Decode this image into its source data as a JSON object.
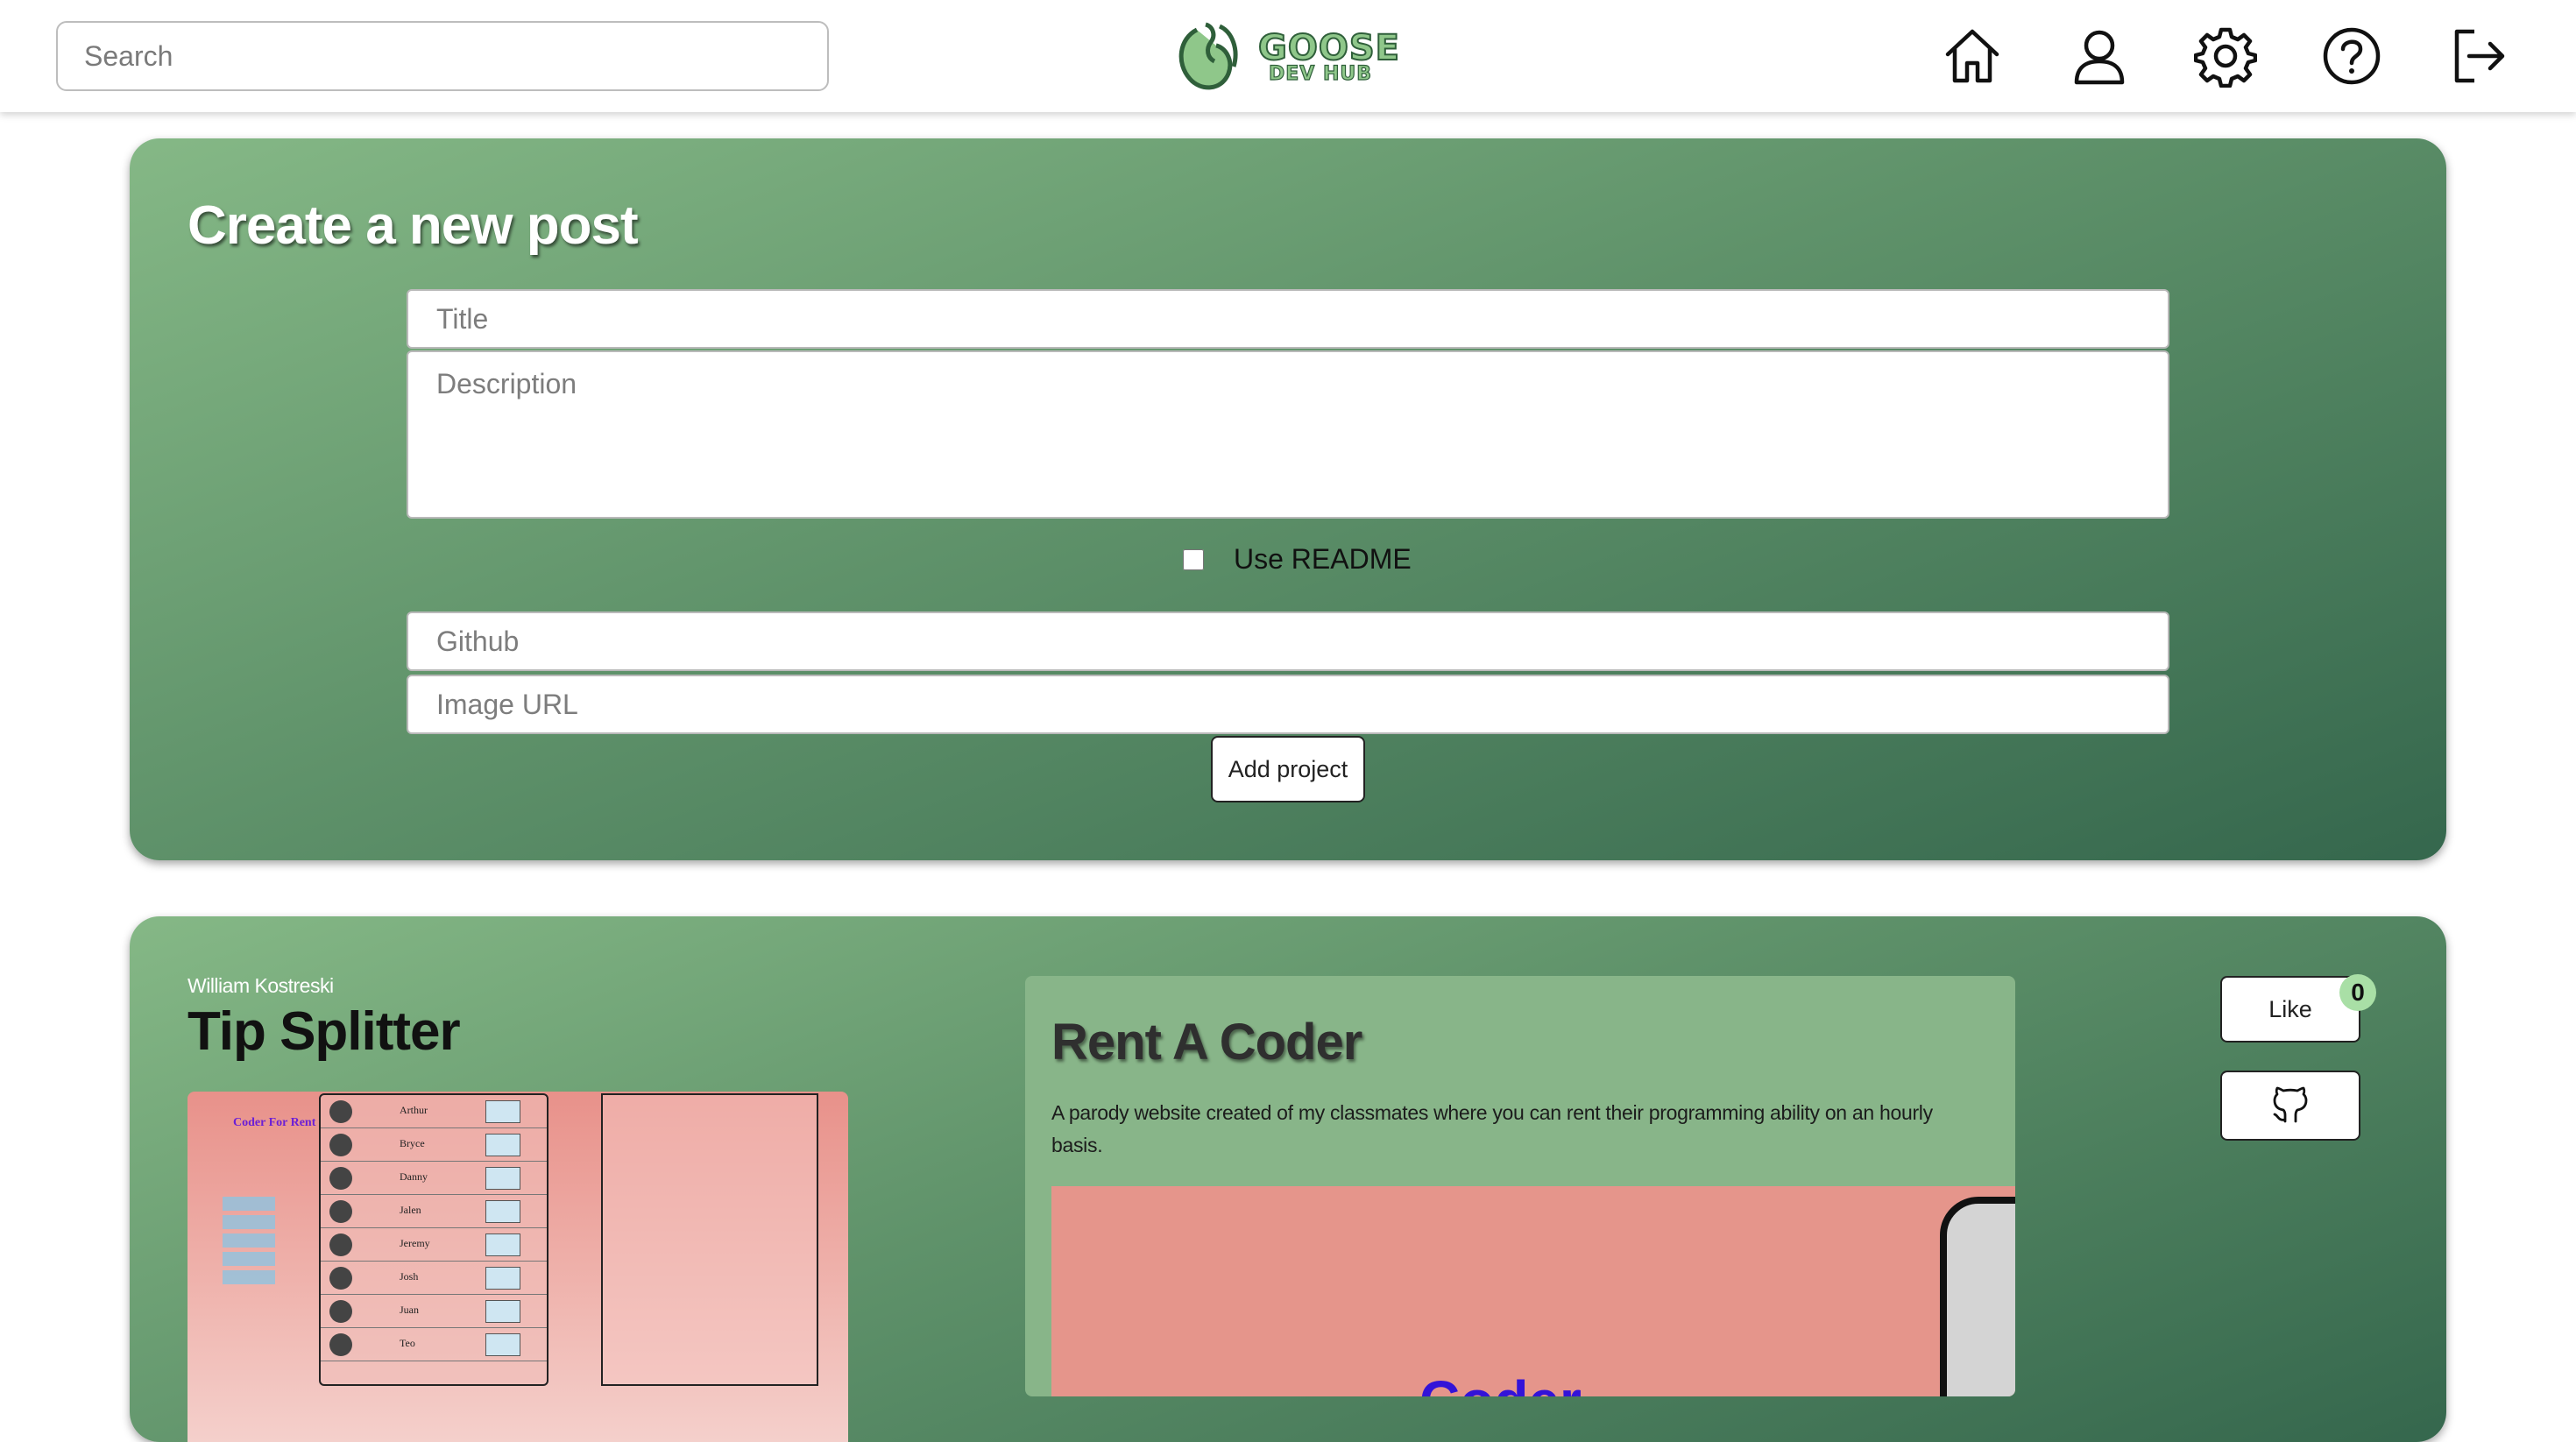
{
  "header": {
    "search_placeholder": "Search",
    "logo_text": "GOOSE",
    "logo_subtext": "DEV HUB",
    "nav_icons": [
      "home-icon",
      "user-icon",
      "gear-icon",
      "help-icon",
      "logout-icon"
    ]
  },
  "create_post": {
    "heading": "Create a new post",
    "title_placeholder": "Title",
    "description_placeholder": "Description",
    "readme_label": "Use README",
    "readme_checked": false,
    "github_placeholder": "Github",
    "image_placeholder": "Image URL",
    "submit_label": "Add project"
  },
  "post": {
    "author": "William Kostreski",
    "title": "Tip Splitter",
    "project_title": "Rent A Coder",
    "description": "A parody website created of my classmates where you can rent their programming ability on an hourly basis.",
    "like_label": "Like",
    "like_count": "0",
    "preview_names": [
      "Arthur",
      "Bryce",
      "Danny",
      "Jalen",
      "Jeremy",
      "Josh",
      "Juan",
      "Teo"
    ],
    "preview_logo": "Coder For Rent",
    "preview_image_word": "Coder"
  },
  "colors": {
    "card_gradient_start": "#85b886",
    "card_gradient_end": "#35674d",
    "panel": "#88b589",
    "badge": "#a9dfa6"
  }
}
